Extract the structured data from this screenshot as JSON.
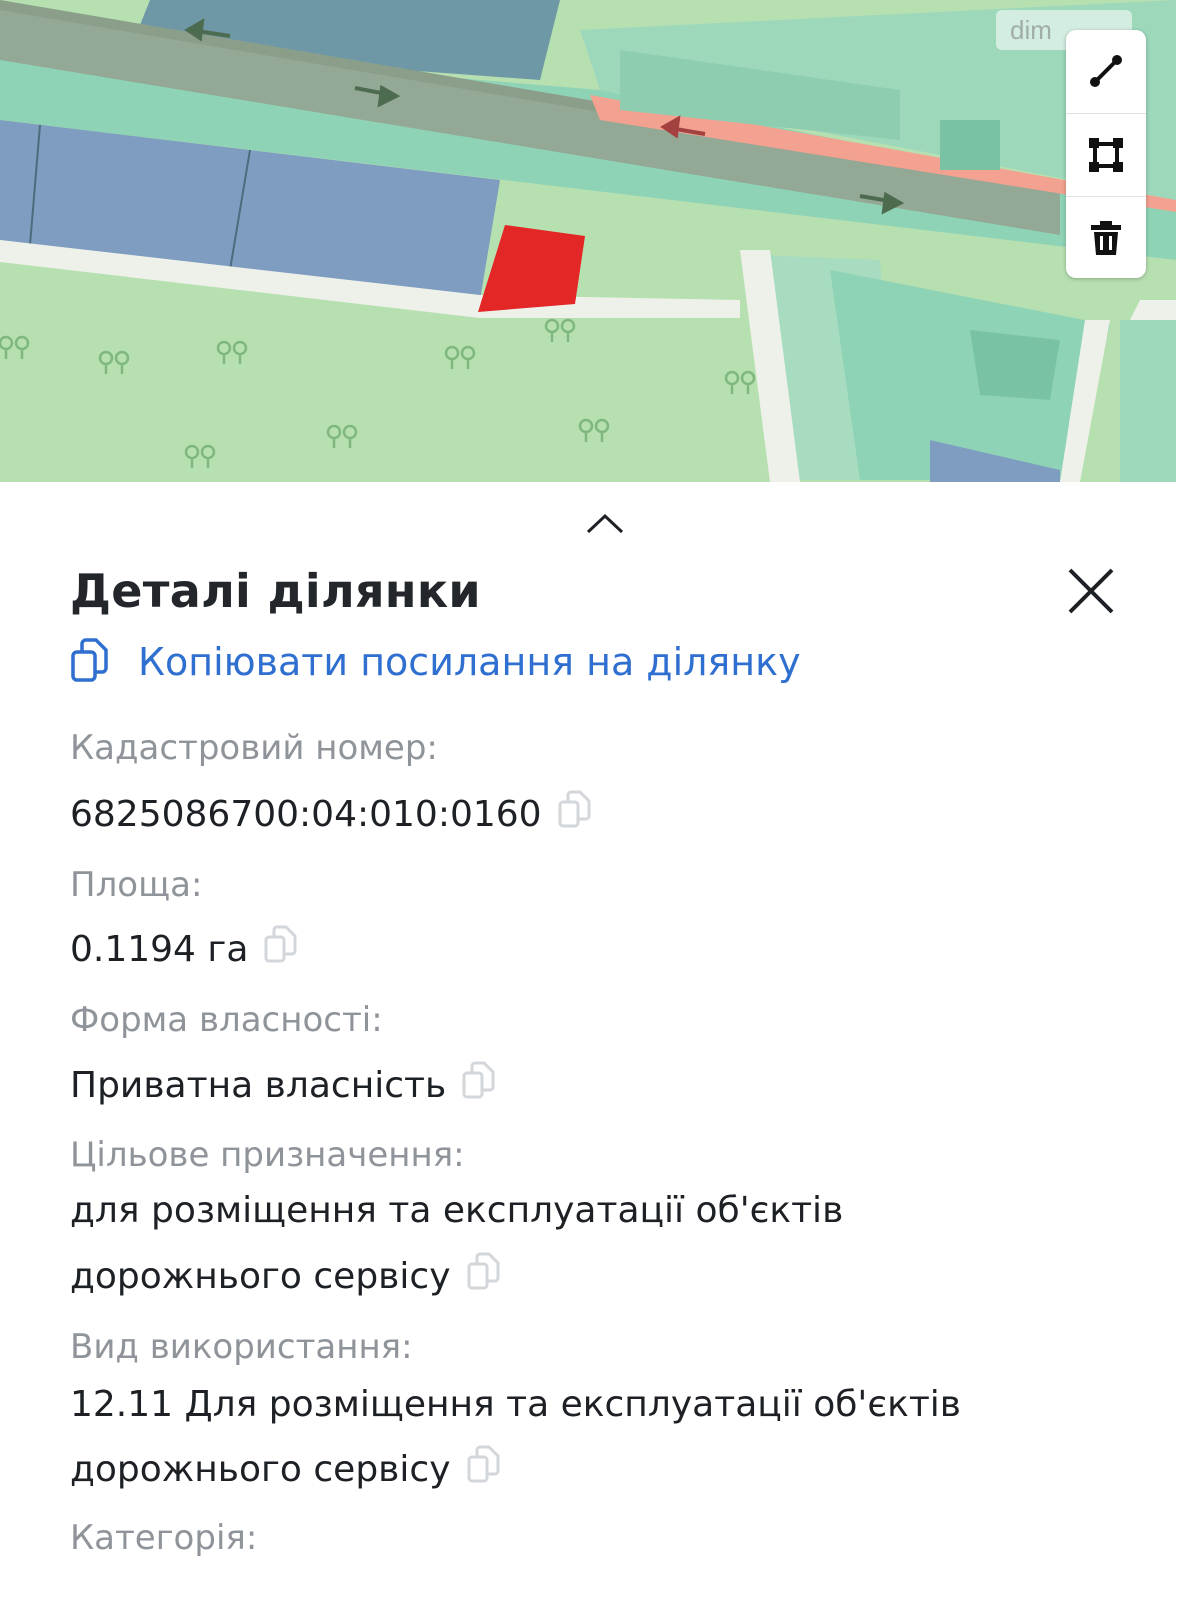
{
  "map": {
    "watermark": "dim",
    "tools": [
      {
        "name": "line-tool-icon"
      },
      {
        "name": "polygon-tool-icon"
      },
      {
        "name": "trash-icon"
      }
    ],
    "colors": {
      "selected_parcel": "#e32626",
      "road": "#98b79a",
      "parcel_blue": "#7f9fbe",
      "parcel_green": "#8fd3b6",
      "forest": "#b9e0b0"
    }
  },
  "panel": {
    "title": "Деталі ділянки",
    "copy_link_label": "Копіювати посилання на ділянку",
    "fields": {
      "cadastral_label": "Кадастровий номер:",
      "cadastral_value": "6825086700:04:010:0160",
      "area_label": "Площа:",
      "area_value": "0.1194 га",
      "ownership_label": "Форма власності:",
      "ownership_value": "Приватна власність",
      "purpose_label": "Цільове призначення:",
      "purpose_line1": "для розміщення та експлуатації об'єктів",
      "purpose_line2": "дорожнього сервісу",
      "usage_label": "Вид використання:",
      "usage_line1": "12.11 Для розміщення та експлуатації об'єктів",
      "usage_line2": "дорожнього сервісу",
      "category_label": "Категорія:"
    },
    "accent_color": "#2f6fd0"
  }
}
